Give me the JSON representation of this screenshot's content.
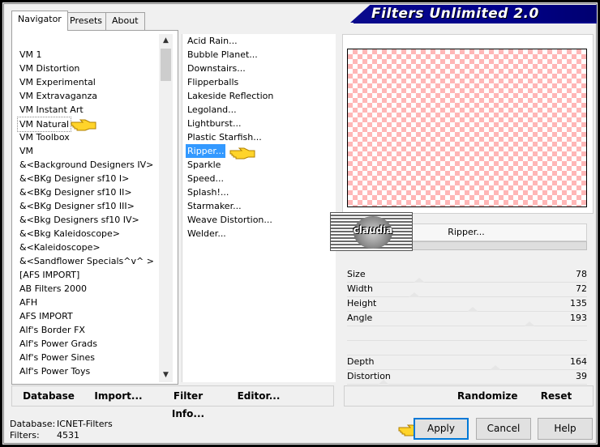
{
  "title": "Filters Unlimited 2.0",
  "tabs": [
    "Navigator",
    "Presets",
    "About"
  ],
  "categories": [
    "VM 1",
    "VM Distortion",
    "VM Experimental",
    "VM Extravaganza",
    "VM Instant Art",
    "VM Natural",
    "VM Toolbox",
    "VM",
    "&<Background Designers IV>",
    "&<BKg Designer sf10 I>",
    "&<BKg Designer sf10 II>",
    "&<BKg Designer sf10 III>",
    "&<Bkg Designers sf10 IV>",
    "&<Bkg Kaleidoscope>",
    "&<Kaleidoscope>",
    "&<Sandflower Specials^v^ >",
    "[AFS IMPORT]",
    "AB Filters 2000",
    "AFH",
    "AFS IMPORT",
    "Alf's Border FX",
    "Alf's Power Grads",
    "Alf's Power Sines",
    "Alf's Power Toys"
  ],
  "selected_category": "VM Natural",
  "filters": [
    "Acid Rain...",
    "Bubble Planet...",
    "Downstairs...",
    "Flipperballs",
    "Lakeside Reflection",
    "Legoland...",
    "Lightburst...",
    "Plastic Starfish...",
    "Ripper...",
    "Sparkle",
    "Speed...",
    "Splash!...",
    "Starmaker...",
    "Weave Distortion...",
    "Welder..."
  ],
  "selected_filter": "Ripper...",
  "logo_text": "claudia",
  "filter_name": "Ripper...",
  "params": [
    {
      "label": "Size",
      "value": "78"
    },
    {
      "label": "Width",
      "value": "72"
    },
    {
      "label": "Height",
      "value": "135"
    },
    {
      "label": "Angle",
      "value": "193"
    },
    {
      "label": "Depth",
      "value": "164"
    },
    {
      "label": "Distortion",
      "value": "39"
    }
  ],
  "left_buttons": [
    "Database",
    "Import...",
    "Filter Info...",
    "Editor..."
  ],
  "right_buttons": [
    "Randomize",
    "Reset"
  ],
  "status": {
    "db_label": "Database:",
    "db_value": "ICNET-Filters",
    "filters_label": "Filters:",
    "filters_value": "4531"
  },
  "dialog_buttons": [
    "Apply",
    "Cancel",
    "Help"
  ],
  "colors": {
    "banner": "#00008b",
    "preview_check": "#ffb6b6",
    "selection": "#3399ff",
    "accent": "#0078d7"
  }
}
